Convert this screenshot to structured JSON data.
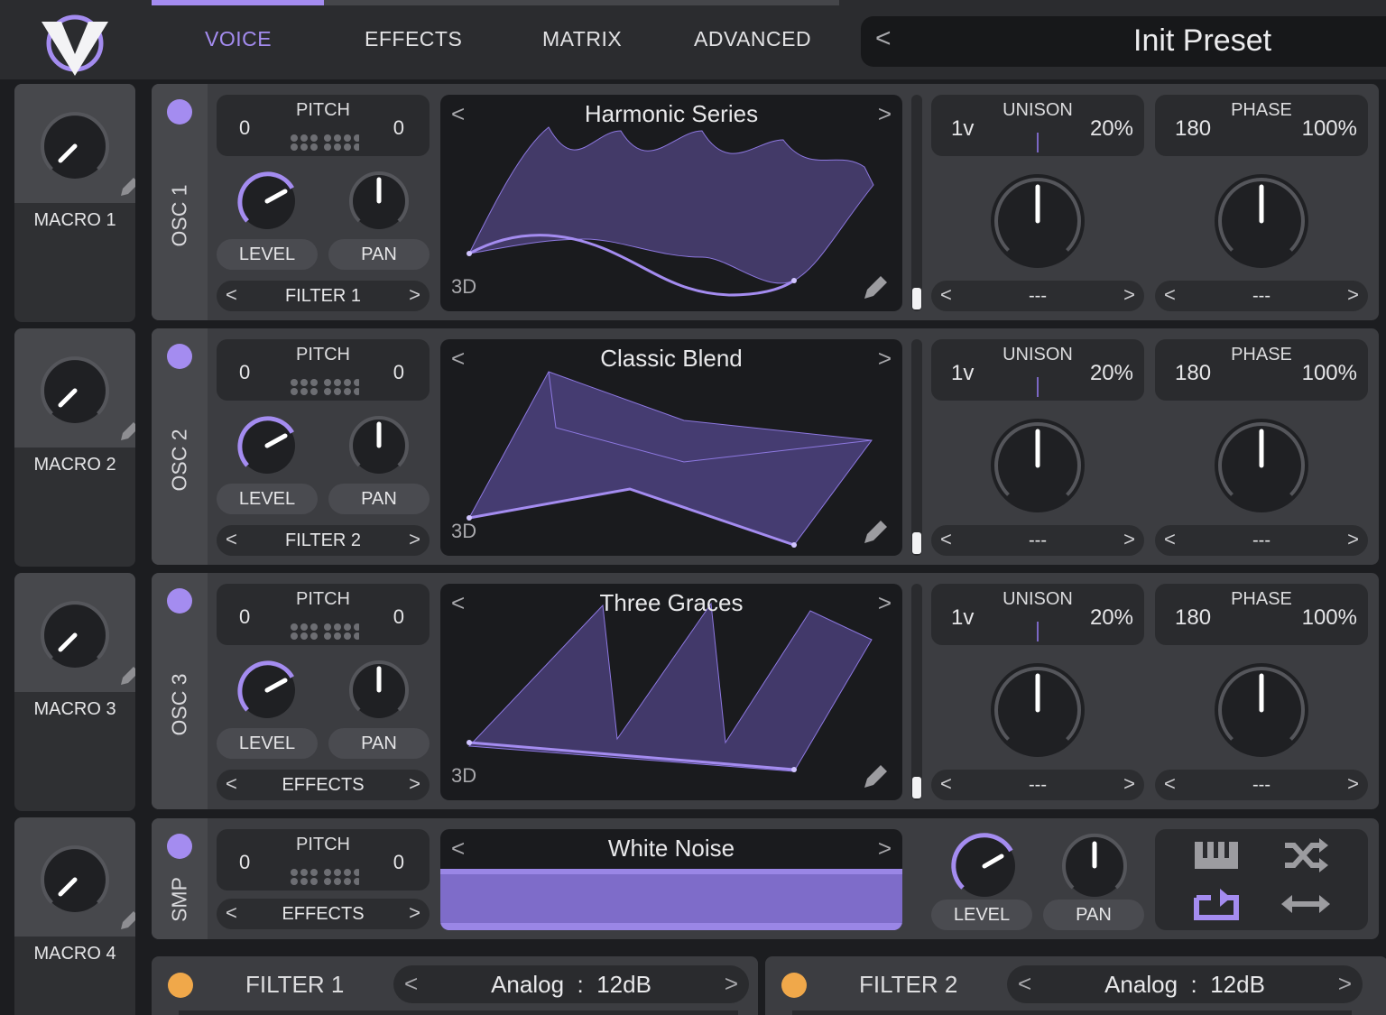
{
  "header": {
    "tabs": [
      "VOICE",
      "EFFECTS",
      "MATRIX",
      "ADVANCED"
    ],
    "active_tab": "VOICE",
    "preset_prev": "<",
    "preset_name": "Init Preset"
  },
  "macros": [
    {
      "label": "MACRO 1"
    },
    {
      "label": "MACRO 2"
    },
    {
      "label": "MACRO 3"
    },
    {
      "label": "MACRO 4"
    }
  ],
  "oscillators": [
    {
      "name": "OSC 1",
      "enabled": true,
      "pitch": {
        "label": "PITCH",
        "left": "0",
        "right": "0"
      },
      "level_label": "LEVEL",
      "pan_label": "PAN",
      "dest": "FILTER 1",
      "wavetable": {
        "name": "Harmonic Series",
        "prev": "<",
        "next": ">",
        "mode": "3D"
      },
      "unison": {
        "label": "UNISON",
        "voices": "1v",
        "detune": "20%"
      },
      "phase": {
        "label": "PHASE",
        "value": "180",
        "random": "100%"
      },
      "unison_select": "---",
      "phase_select": "---"
    },
    {
      "name": "OSC 2",
      "enabled": true,
      "pitch": {
        "label": "PITCH",
        "left": "0",
        "right": "0"
      },
      "level_label": "LEVEL",
      "pan_label": "PAN",
      "dest": "FILTER 2",
      "wavetable": {
        "name": "Classic Blend",
        "prev": "<",
        "next": ">",
        "mode": "3D"
      },
      "unison": {
        "label": "UNISON",
        "voices": "1v",
        "detune": "20%"
      },
      "phase": {
        "label": "PHASE",
        "value": "180",
        "random": "100%"
      },
      "unison_select": "---",
      "phase_select": "---"
    },
    {
      "name": "OSC 3",
      "enabled": true,
      "pitch": {
        "label": "PITCH",
        "left": "0",
        "right": "0"
      },
      "level_label": "LEVEL",
      "pan_label": "PAN",
      "dest": "EFFECTS",
      "wavetable": {
        "name": "Three Graces",
        "prev": "<",
        "next": ">",
        "mode": "3D"
      },
      "unison": {
        "label": "UNISON",
        "voices": "1v",
        "detune": "20%"
      },
      "phase": {
        "label": "PHASE",
        "value": "180",
        "random": "100%"
      },
      "unison_select": "---",
      "phase_select": "---"
    }
  ],
  "sampler": {
    "name": "SMP",
    "enabled": true,
    "pitch": {
      "label": "PITCH",
      "left": "0",
      "right": "0"
    },
    "dest": "EFFECTS",
    "sample": {
      "name": "White Noise",
      "prev": "<",
      "next": ">"
    },
    "level_label": "LEVEL",
    "pan_label": "PAN",
    "icons": [
      "keyboard-track-icon",
      "random-phase-icon",
      "loop-icon",
      "bounce-icon"
    ]
  },
  "filters": [
    {
      "name": "FILTER 1",
      "model": "Analog",
      "sep": ":",
      "slope": "12dB",
      "prev": "<",
      "next": ">"
    },
    {
      "name": "FILTER 2",
      "model": "Analog",
      "sep": ":",
      "slope": "12dB",
      "prev": "<",
      "next": ">"
    }
  ],
  "colors": {
    "accent": "#a48cf0",
    "filter_dot": "#f0a84a",
    "panel": "#3c3d41",
    "dark": "#1a1b1e"
  }
}
